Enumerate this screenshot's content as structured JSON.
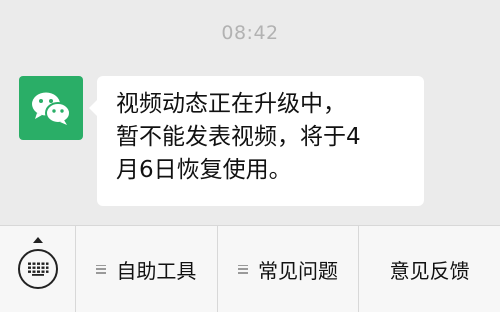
{
  "chat": {
    "timestamp": "08:42",
    "message": "视频动态正在升级中，\n暂不能发表视频，将于4\n月6日恢复使用。",
    "avatar_icon": "wechat-icon",
    "avatar_color": "#2aae67"
  },
  "bottom_bar": {
    "keyboard_icon": "keyboard-icon",
    "items": [
      {
        "label": "自助工具",
        "has_menu_icon": true
      },
      {
        "label": "常见问题",
        "has_menu_icon": true
      },
      {
        "label": "意见反馈",
        "has_menu_icon": false
      }
    ]
  }
}
